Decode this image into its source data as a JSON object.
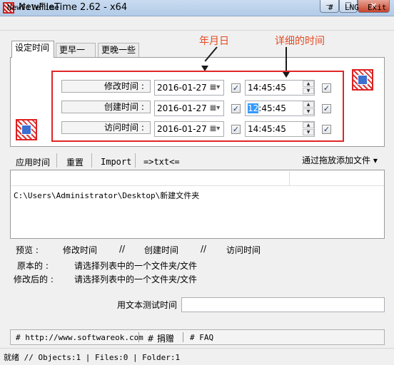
{
  "window": {
    "title": "NewFileTime 2.62 - x64",
    "controls": {
      "minimize": "—",
      "maximize": "□",
      "close": "✕"
    }
  },
  "menubar": {
    "left": "NewFileTime",
    "right": [
      "#",
      "LNG",
      "Exit"
    ]
  },
  "tabs": [
    "设定时间",
    "更早一些",
    "更晚一些"
  ],
  "annotations": {
    "date_label": "年月日",
    "time_label": "详细的时间"
  },
  "time_rows": [
    {
      "label": "修改时间 :",
      "date": "2016-01-27",
      "time_hour": "",
      "time_rest": "14:45:45",
      "checked_date": true,
      "checked_time": true
    },
    {
      "label": "创建时间 :",
      "date": "2016-01-27",
      "time_hour": "12",
      "time_rest": ":45:45",
      "checked_date": true,
      "checked_time": true
    },
    {
      "label": "访问时间 :",
      "date": "2016-01-27",
      "time_hour": "",
      "time_rest": "14:45:45",
      "checked_date": true,
      "checked_time": true
    }
  ],
  "toolbar": {
    "apply": "应用时间",
    "reset": "重置",
    "import": "Import",
    "txt": "=>txt<=",
    "drag_add": "通过拖放添加文件"
  },
  "file_list": [
    "C:\\Users\\Administrator\\Desktop\\新建文件夹"
  ],
  "preview": {
    "headers": [
      "预览 :",
      "修改时间",
      "//",
      "创建时间",
      "//",
      "访问时间"
    ],
    "original_label": "原本的 :",
    "original_value": "请选择列表中的一个文件夹/文件",
    "modified_label": "修改后的 :",
    "modified_value": "请选择列表中的一个文件夹/文件"
  },
  "text_test": {
    "label": "用文本测试时间",
    "value": ""
  },
  "bottom_links": [
    "# http://www.softwareok.com",
    "# 捐赠",
    "# FAQ"
  ],
  "status": "就绪 // Objects:1 | Files:0 | Folder:1",
  "icons": {
    "calendar": "calendar-icon",
    "checkbox": "checkbox-icon",
    "app": "app-icon"
  }
}
